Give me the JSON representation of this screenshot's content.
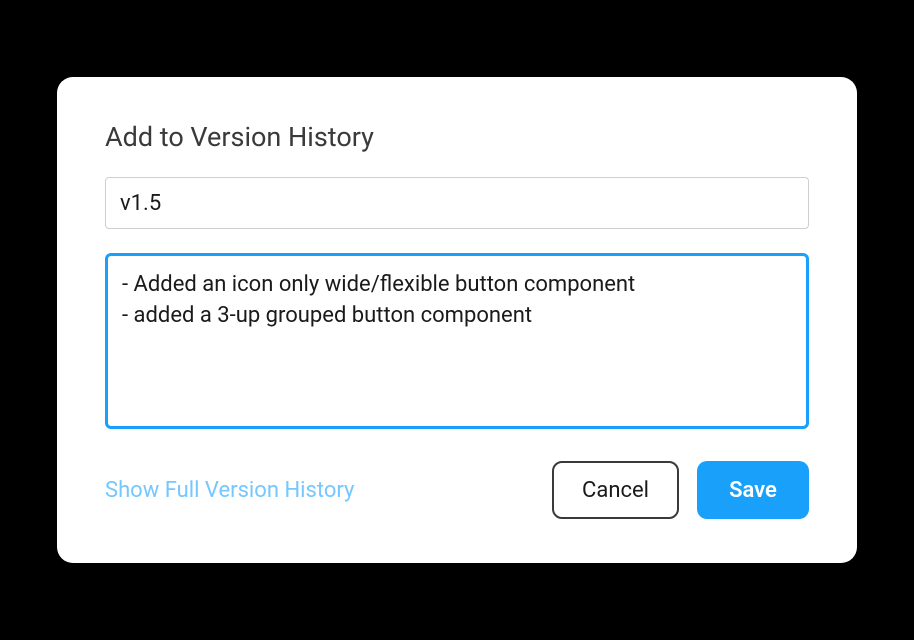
{
  "dialog": {
    "title": "Add to Version History",
    "version_value": "v1.5",
    "description_value": "- Added an icon only wide/flexible button component\n- added a 3-up grouped button component",
    "history_link": "Show Full Version History",
    "cancel_label": "Cancel",
    "save_label": "Save",
    "colors": {
      "accent": "#18a0fb",
      "link": "#74c7ff"
    }
  }
}
